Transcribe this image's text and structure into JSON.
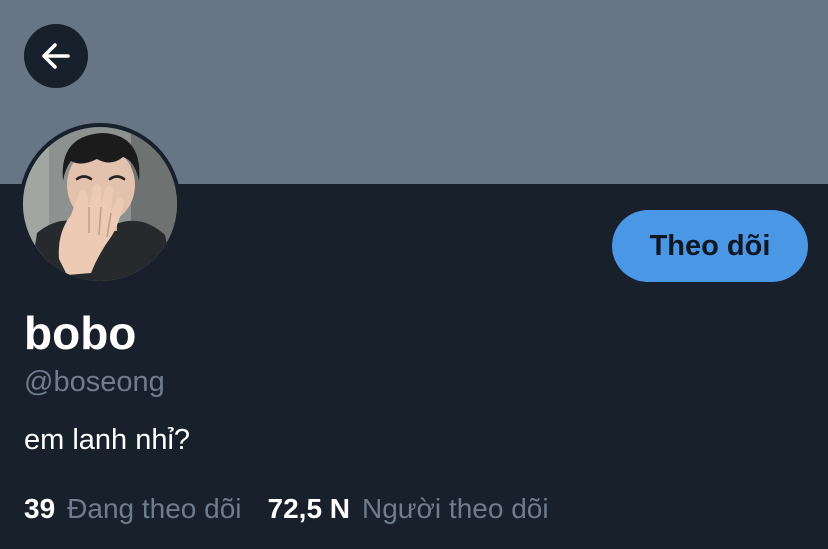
{
  "profile": {
    "display_name": "bobo",
    "handle": "@boseong",
    "bio": "em lanh nhỉ?",
    "follow_button_label": "Theo dõi"
  },
  "stats": {
    "following_count": "39",
    "following_label": "Đang theo dõi",
    "followers_count": "72,5 N",
    "followers_label": "Người theo dõi"
  },
  "icons": {
    "back": "arrow-left-icon"
  },
  "colors": {
    "banner": "#687585",
    "background": "#18202c",
    "accent": "#4a97e6",
    "muted_text": "#6f7c8b"
  }
}
